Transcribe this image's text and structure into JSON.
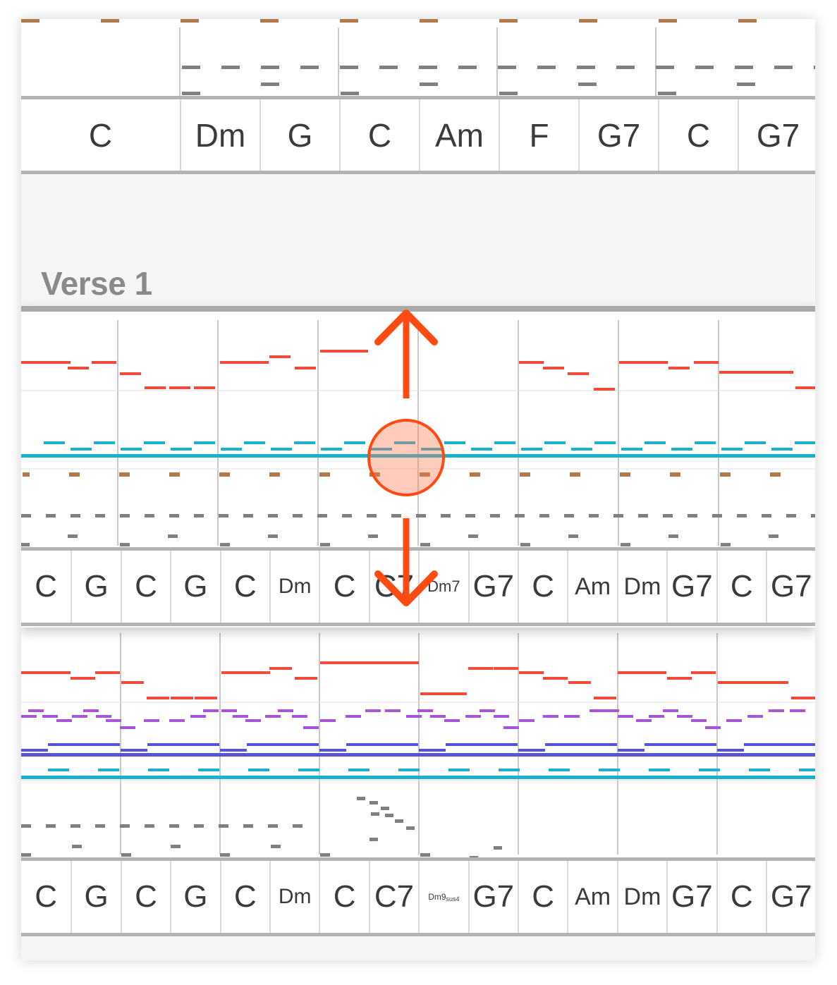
{
  "section": {
    "title": "Verse 1"
  },
  "intro": {
    "chords": [
      "C",
      "Dm",
      "G",
      "C",
      "Am",
      "F",
      "G7",
      "C",
      "G7"
    ]
  },
  "verse1": {
    "chords": [
      {
        "name": "C"
      },
      {
        "name": "G"
      },
      {
        "name": "C"
      },
      {
        "name": "G"
      },
      {
        "name": "C"
      },
      {
        "name": "Dm"
      },
      {
        "name": "C"
      },
      {
        "name": "C7"
      },
      {
        "name": "Dm7"
      },
      {
        "name": "G7"
      },
      {
        "name": "C"
      },
      {
        "name": "Am"
      },
      {
        "name": "Dm"
      },
      {
        "name": "G7"
      },
      {
        "name": "C"
      },
      {
        "name": "G7"
      }
    ]
  },
  "verse2": {
    "chords": [
      {
        "name": "C"
      },
      {
        "name": "G"
      },
      {
        "name": "C"
      },
      {
        "name": "G"
      },
      {
        "name": "C"
      },
      {
        "name": "Dm"
      },
      {
        "name": "C"
      },
      {
        "name": "C7"
      },
      {
        "name": "Dm9",
        "sub": "sus4"
      },
      {
        "name": "G7"
      },
      {
        "name": "C"
      },
      {
        "name": "Am"
      },
      {
        "name": "Dm"
      },
      {
        "name": "G7"
      },
      {
        "name": "C"
      },
      {
        "name": "G7"
      }
    ]
  },
  "colors": {
    "melody": "#f04a3f",
    "bass": "#1ab0d0",
    "accent": "#ff4a12",
    "chord_purple": "#a855d8",
    "chord_blue": "#5555d8",
    "drum_brown": "#b07a4a",
    "drum_gray": "#808080",
    "chord_text": "#3b3b3b",
    "section_title": "#8a8a8a"
  },
  "gesture": {
    "icon": "resize-vertical-drag-icon"
  }
}
